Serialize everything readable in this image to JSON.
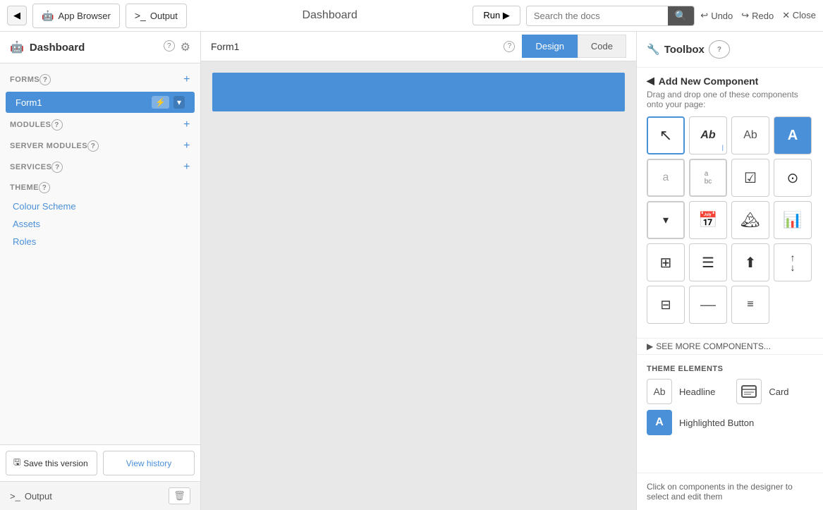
{
  "topbar": {
    "back_icon": "◀",
    "tab_appbrowser_icon": "🤖",
    "tab_appbrowser_label": "App Browser",
    "tab_output_icon": ">_",
    "tab_output_label": "Output",
    "title": "Dashboard",
    "run_label": "Run ▶",
    "search_placeholder": "Search the docs",
    "search_icon": "🔍",
    "undo_label": "Undo",
    "redo_label": "Redo",
    "close_label": "✕ Close"
  },
  "sidebar": {
    "title": "Dashboard",
    "icon": "🤖",
    "sections": {
      "forms_label": "FORMS",
      "modules_label": "MODULES",
      "server_modules_label": "SERVER MODULES",
      "services_label": "SERVICES",
      "theme_label": "THEME"
    },
    "form_item": {
      "label": "Form1",
      "icon": "⚡",
      "dropdown": "▾"
    },
    "theme_links": [
      "Colour Scheme",
      "Assets",
      "Roles"
    ],
    "save_button": "Save this version",
    "save_icon": "🖫",
    "history_link": "View history",
    "output_title": "Output",
    "output_prefix": ">_"
  },
  "canvas": {
    "form_title": "Form1",
    "help_icon": "?",
    "tab_design": "Design",
    "tab_code": "Code"
  },
  "toolbox": {
    "title": "Toolbox",
    "wrench_icon": "🔧",
    "help_icon": "?",
    "add_component_title": "Add New Component",
    "collapse_icon": "◀",
    "desc": "Drag and drop one of these components onto your page:",
    "components": [
      {
        "name": "pointer",
        "label": "↖",
        "type": "cursor"
      },
      {
        "name": "text-cursor",
        "label": "Ab",
        "type": "text-cursor"
      },
      {
        "name": "label",
        "label": "Ab",
        "type": "label"
      },
      {
        "name": "button",
        "label": "A",
        "type": "button-blue"
      },
      {
        "name": "input",
        "label": "a",
        "type": "input"
      },
      {
        "name": "textarea",
        "label": "a\nbc",
        "type": "textarea"
      },
      {
        "name": "checkbox",
        "label": "☑",
        "type": "checkbox"
      },
      {
        "name": "radio",
        "label": "⊙",
        "type": "radio"
      },
      {
        "name": "dropdown",
        "label": "▾",
        "type": "dropdown"
      },
      {
        "name": "datepicker",
        "label": "📅",
        "type": "calendar"
      },
      {
        "name": "image",
        "label": "🏔",
        "type": "image"
      },
      {
        "name": "chart",
        "label": "📊",
        "type": "chart"
      },
      {
        "name": "datagrid",
        "label": "▦",
        "type": "datagrid"
      },
      {
        "name": "repeater",
        "label": "≡",
        "type": "repeater"
      },
      {
        "name": "file-upload",
        "label": "⬆",
        "type": "upload"
      },
      {
        "name": "spacer",
        "label": "⬆\n⬇",
        "type": "spacer"
      },
      {
        "name": "columns",
        "label": "⊞",
        "type": "columns"
      },
      {
        "name": "hline",
        "label": "—",
        "type": "hline"
      },
      {
        "name": "rich-text",
        "label": "≡",
        "type": "rich-text"
      }
    ],
    "see_more": "SEE MORE COMPONENTS...",
    "theme_elements_title": "THEME ELEMENTS",
    "theme_elements": [
      {
        "icon_label": "Ab",
        "name": "Headline",
        "type": "text"
      },
      {
        "icon_label": "⊞",
        "name": "Card",
        "type": "card"
      },
      {
        "icon_label": "A",
        "name": "Highlighted Button",
        "type": "button-blue"
      }
    ],
    "click_hint": "Click on components in the designer to select and edit them"
  }
}
